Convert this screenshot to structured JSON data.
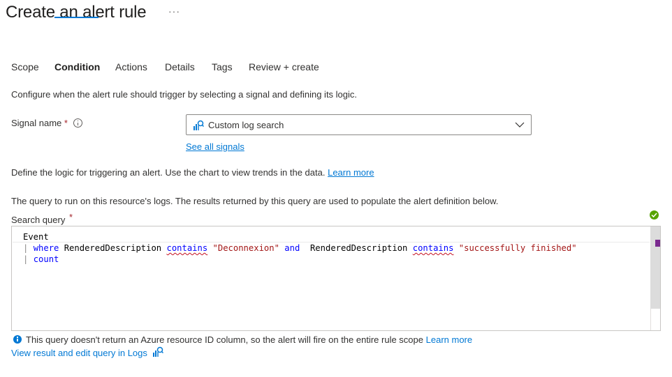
{
  "page": {
    "title": "Create an alert rule",
    "more_label": "···"
  },
  "tabs": [
    {
      "label": "Scope"
    },
    {
      "label": "Condition",
      "active": true
    },
    {
      "label": "Actions"
    },
    {
      "label": "Details"
    },
    {
      "label": "Tags"
    },
    {
      "label": "Review + create"
    }
  ],
  "condition": {
    "intro": "Configure when the alert rule should trigger by selecting a signal and defining its logic.",
    "signal_label": "Signal name",
    "required_mark": "*",
    "signal_value": "Custom log search",
    "see_all_signals": "See all signals",
    "logic_text": "Define the logic for triggering an alert. Use the chart to view trends in the data.",
    "learn_more": "Learn more",
    "query_text": "The query to run on this resource's logs. The results returned by this query are used to populate the alert definition below.",
    "search_query_label": "Search query"
  },
  "query": {
    "line1": "Event",
    "line2": {
      "pipe": "|",
      "where": "where",
      "field1": "RenderedDescription",
      "op1": "contains",
      "str1": "\"Deconnexion\"",
      "and": "and",
      "field2": "RenderedDescription",
      "op2": "contains",
      "str2": "\"successfully finished\""
    },
    "line3": {
      "pipe": "|",
      "count": "count"
    }
  },
  "footer": {
    "note": "This query doesn't return an Azure resource ID column, so the alert will fire on the entire rule scope",
    "note_link": "Learn more",
    "view_logs": "View result and edit query in Logs"
  },
  "colors": {
    "accent": "#0078d4",
    "success": "#57a300",
    "required": "#a4262c"
  },
  "icons": [
    "info-icon",
    "log-search-icon",
    "chevron-down-icon",
    "check-circle-icon",
    "info-filled-icon",
    "logs-icon"
  ]
}
